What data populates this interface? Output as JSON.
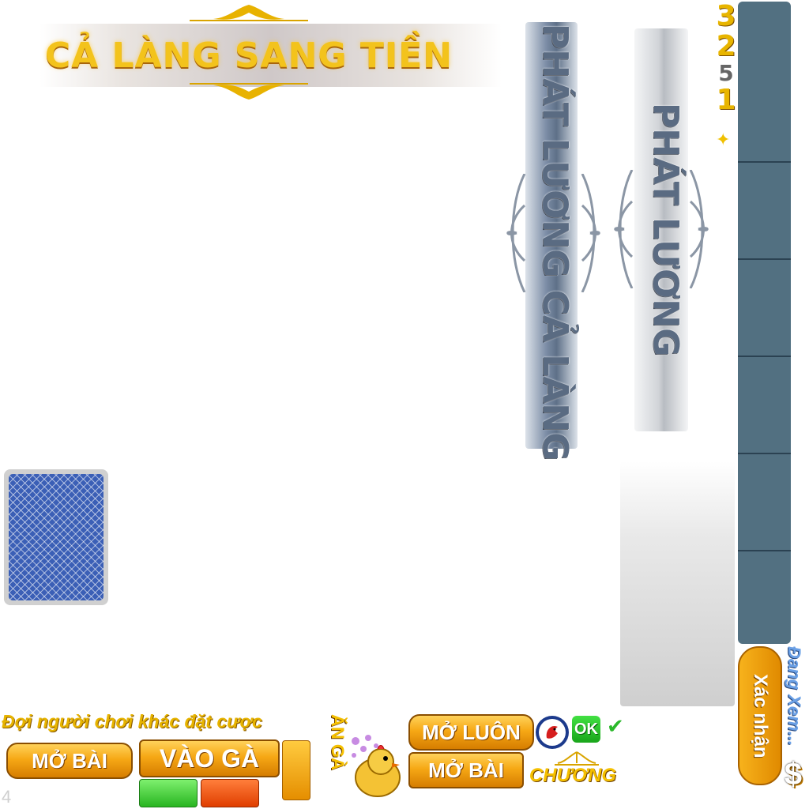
{
  "title": "CẢ LÀNG SANG TIỀN",
  "banners": {
    "left_vertical": "PHÁT LƯƠNG CẢ LÀNG",
    "right_vertical": "PHÁT LƯƠNG"
  },
  "countdown": [
    "3",
    "2",
    "5",
    "1"
  ],
  "status": {
    "waiting": "Đợi người chơi khác đặt cược",
    "watching": "Đang Xem..."
  },
  "buttons": {
    "open_left": "MỞ BÀI",
    "enter_chicken": "VÀO GÀ",
    "open_now": "MỞ LUÔN",
    "open_right": "MỞ BÀI",
    "confirm": "Xác nhận",
    "ok": "OK"
  },
  "labels": {
    "eat_chicken": "ĂN GÀ",
    "dealer": "CHƯƠNG",
    "money_symbol": "$",
    "corner": "4"
  },
  "icons": [
    "star-icon",
    "card-back",
    "chicken-icon",
    "rooster-icon",
    "check-icon",
    "money-icon"
  ],
  "colors": {
    "gold": "#f3c31c",
    "sidebar": "#527081",
    "button_orange": "#f6a815"
  }
}
